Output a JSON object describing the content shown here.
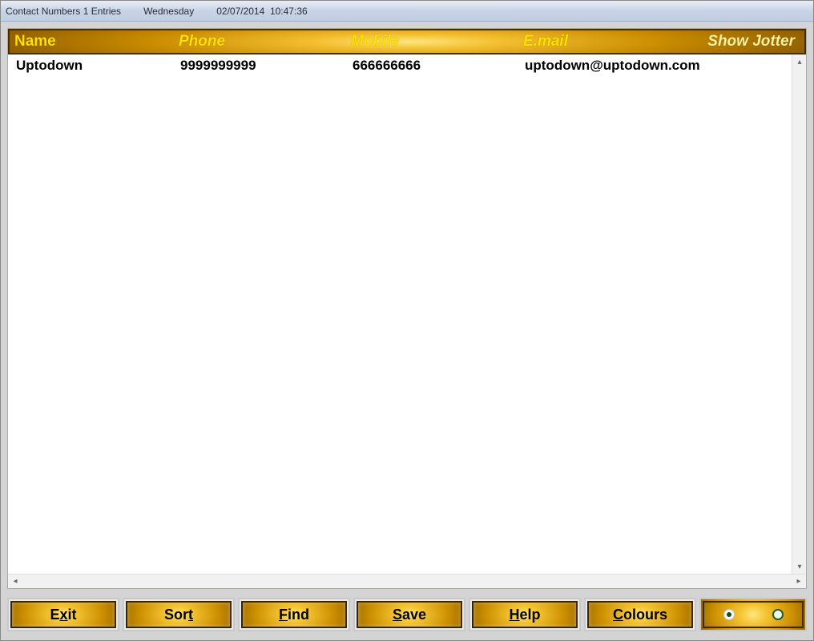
{
  "titlebar": {
    "title": "Contact Numbers 1 Entries",
    "day": "Wednesday",
    "date": "02/07/2014",
    "time": "10:47:36"
  },
  "columns": {
    "name": "Name",
    "phone": "Phone",
    "mobile": "Mobile",
    "email": "E.mail",
    "jotter": "Show Jotter"
  },
  "rows": [
    {
      "name": "Uptodown",
      "phone": "9999999999",
      "mobile": "666666666",
      "email": "uptodown@uptodown.com"
    }
  ],
  "buttons": {
    "exit": {
      "prefix": "E",
      "accel": "x",
      "suffix": "it"
    },
    "sort": {
      "prefix": "Sor",
      "accel": "t",
      "suffix": ""
    },
    "find": {
      "prefix": "",
      "accel": "F",
      "suffix": "ind"
    },
    "save": {
      "prefix": "",
      "accel": "S",
      "suffix": "ave"
    },
    "help": {
      "prefix": "",
      "accel": "H",
      "suffix": "elp"
    },
    "colours": {
      "prefix": "",
      "accel": "C",
      "suffix": "olours"
    }
  },
  "radios": {
    "left_selected": true,
    "right_selected": false
  },
  "colors": {
    "gold_light": "#ffe680",
    "gold_mid": "#f3bf2f",
    "gold_dark": "#7a4d00",
    "header_text": "#ffe000"
  }
}
